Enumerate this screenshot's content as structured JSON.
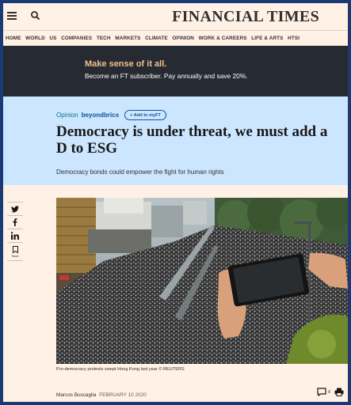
{
  "header": {
    "brand": "FINANCIAL TIMES",
    "menu_icon": "hamburger-menu-icon",
    "search_icon": "search-icon"
  },
  "nav": {
    "items": [
      "HOME",
      "WORLD",
      "US",
      "COMPANIES",
      "TECH",
      "MARKETS",
      "CLIMATE",
      "OPINION",
      "WORK & CAREERS",
      "LIFE & ARTS",
      "HTSI"
    ]
  },
  "promo": {
    "title": "Make sense of it all.",
    "subtitle": "Become an FT subscriber. Pay annually and save 20%."
  },
  "article": {
    "section": "Opinion",
    "topic": "beyondbrics",
    "add_label": "+ Add to myFT",
    "headline": "Democracy is under threat, we must add a D to ESG",
    "standfirst": "Democracy bonds could empower the fight for human rights",
    "caption": "Pro-democracy protests swept Hong Kong last year © REUTERS",
    "author": "Marcos Buscaglia",
    "date": "FEBRUARY 10 2020",
    "comment_count": "8"
  },
  "share": {
    "icons": [
      "twitter-icon",
      "facebook-icon",
      "linkedin-icon",
      "bookmark-icon"
    ],
    "save_label": "Save"
  },
  "colors": {
    "page_bg": "#fff1e5",
    "promo_bg": "#262a33",
    "promo_accent": "#f2c08c",
    "headline_bg": "#cce6ff",
    "link_blue": "#0f5499",
    "teal": "#0d7680",
    "frame": "#1b3a73"
  }
}
